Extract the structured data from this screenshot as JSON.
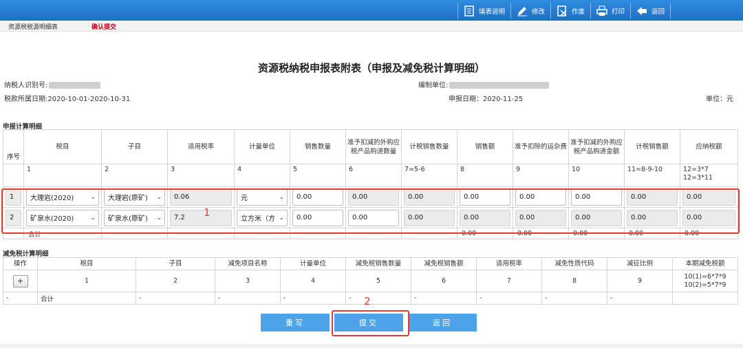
{
  "toolbar": {
    "items": [
      {
        "label": "填表说明",
        "icon": "document-icon"
      },
      {
        "label": "修改",
        "icon": "pencil-icon"
      },
      {
        "label": "作废",
        "icon": "void-document-icon"
      },
      {
        "label": "打印",
        "icon": "printer-icon"
      },
      {
        "label": "返回",
        "icon": "back-arrow-icon"
      }
    ]
  },
  "subbar": {
    "tab1": "资源税税源明细表",
    "tab2": "确认提交"
  },
  "title": "资源税纳税申报表附表（申报及减免税计算明细）",
  "meta": {
    "taxpayer_id_label": "纳税人识别号:",
    "prep_unit_label": "编制单位:",
    "period": "税款所属日期:2020-10-01-2020-10-31",
    "report_date": "申报日期：2020-11-25",
    "unit": "单位：元"
  },
  "section1": {
    "label": "申报计算明细",
    "headers": [
      "序号",
      "税目",
      "子目",
      "适用税率",
      "计量单位",
      "销售数量",
      "准予扣减的外购应税产品购进数量",
      "计税销售数量",
      "销售额",
      "准予扣除的运杂费",
      "准予扣减的外购应税产品购进金额",
      "计税销售额",
      "应纳税额"
    ],
    "index_row": [
      "",
      "1",
      "2",
      "3",
      "4",
      "5",
      "6",
      "7=5-6",
      "8",
      "9",
      "10",
      "11=8-9-10",
      "12=3*7\n12=3*11"
    ],
    "rows": [
      {
        "seq": "1",
        "item": "大理岩(2020)",
        "subitem": "大理岩(原矿)",
        "rate": "0.06",
        "unit": "元",
        "qty": "0.00",
        "deduct_qty": "0.00",
        "taxable_qty": "0.00",
        "sales": "0.00",
        "freight": "0.00",
        "deduct_amt": "0.00",
        "taxable_sales": "0.00",
        "tax": "0.00"
      },
      {
        "seq": "2",
        "item": "矿泉水(2020)",
        "subitem": "矿泉水(原矿)",
        "rate": "7.2",
        "unit": "立方米（方",
        "qty": "0.00",
        "deduct_qty": "0.00",
        "taxable_qty": "0.00",
        "sales": "0.00",
        "freight": "0.00",
        "deduct_amt": "0.00",
        "taxable_sales": "0.00",
        "tax": "0.00"
      }
    ],
    "sum_row": [
      "-",
      "合计",
      "-",
      "-",
      "-",
      "-",
      "-",
      "-",
      "0.00",
      "0.00",
      "0.00",
      "0.00",
      "0.00"
    ]
  },
  "section2": {
    "label": "减免税计算明细",
    "headers": [
      "操作",
      "税目",
      "子目",
      "减免项目名称",
      "计量单位",
      "减免税销售数量",
      "减免税销售额",
      "适用税率",
      "减免性质代码",
      "减征比例",
      "本期减免税额"
    ],
    "index_row": [
      "+",
      "1",
      "2",
      "3",
      "4",
      "5",
      "6",
      "7",
      "8",
      "9",
      "10(1)=6*7*9\n10(2)=5*7*9"
    ],
    "sum_row": [
      "-",
      "合计",
      "-",
      "-",
      "-",
      "-",
      "-",
      "-",
      "-",
      "-",
      ""
    ]
  },
  "buttons": {
    "reset": "重写",
    "submit": "提交",
    "back": "返回"
  },
  "annotations": {
    "one": "1",
    "two": "2"
  },
  "colors": {
    "toolbar": "#1f6fc4",
    "button": "#4da3e8",
    "annotation": "#e53935"
  }
}
